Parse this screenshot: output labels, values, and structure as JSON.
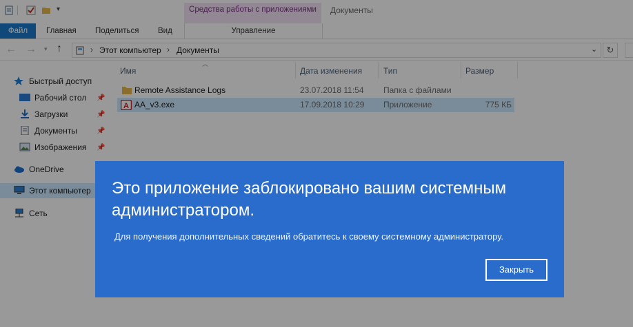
{
  "window": {
    "title": "Документы",
    "contextual_tab_group": "Средства работы с приложениями"
  },
  "ribbon": {
    "tabs": [
      "Файл",
      "Главная",
      "Поделиться",
      "Вид"
    ],
    "contextual_tab": "Управление"
  },
  "address": {
    "breadcrumb": [
      "Этот компьютер",
      "Документы"
    ],
    "separator": "›"
  },
  "nav": {
    "quick_access": "Быстрый доступ",
    "items": [
      {
        "label": "Рабочий стол",
        "pinned": true
      },
      {
        "label": "Загрузки",
        "pinned": true
      },
      {
        "label": "Документы",
        "pinned": true
      },
      {
        "label": "Изображения",
        "pinned": true
      }
    ],
    "onedrive": "OneDrive",
    "this_pc": "Этот компьютер",
    "network": "Сеть"
  },
  "columns": {
    "name": "Имя",
    "modified": "Дата изменения",
    "type": "Тип",
    "size": "Размер"
  },
  "files": [
    {
      "name": "Remote Assistance Logs",
      "modified": "23.07.2018 11:54",
      "type": "Папка с файлами",
      "size": ""
    },
    {
      "name": "AA_v3.exe",
      "modified": "17.09.2018 10:29",
      "type": "Приложение",
      "size": "775 КБ"
    }
  ],
  "dialog": {
    "title": "Это приложение заблокировано вашим системным администратором.",
    "message": "Для получения дополнительных сведений обратитесь к своему системному администратору.",
    "close_label": "Закрыть"
  },
  "colors": {
    "file_tab": "#1979ca",
    "dialog_bg": "#2a6ccc",
    "selection": "#cce8ff",
    "contextual_tab": "#f3e3f6"
  }
}
